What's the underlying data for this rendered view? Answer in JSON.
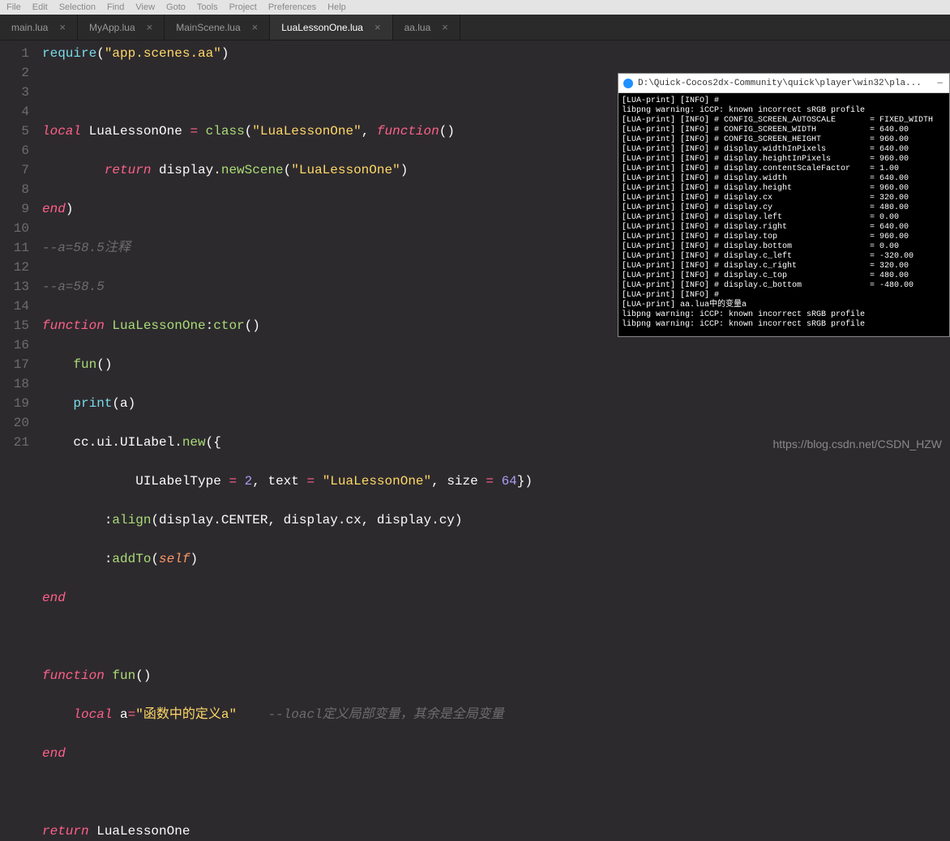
{
  "menu": [
    "File",
    "Edit",
    "Selection",
    "Find",
    "View",
    "Goto",
    "Tools",
    "Project",
    "Preferences",
    "Help"
  ],
  "tabs": [
    {
      "label": "main.lua",
      "active": false
    },
    {
      "label": "MyApp.lua",
      "active": false
    },
    {
      "label": "MainScene.lua",
      "active": false
    },
    {
      "label": "LuaLessonOne.lua",
      "active": true
    },
    {
      "label": "aa.lua",
      "active": false
    }
  ],
  "code": {
    "l1a": "require",
    "l1b": "(",
    "l1c": "\"app.scenes.aa\"",
    "l1d": ")",
    "l3a": "local",
    "l3b": " LuaLessonOne ",
    "l3c": "=",
    "l3d": " ",
    "l3e": "class",
    "l3f": "(",
    "l3g": "\"LuaLessonOne\"",
    "l3h": ", ",
    "l3i": "function",
    "l3j": "()",
    "l4a": "        ",
    "l4b": "return",
    "l4c": " display.",
    "l4d": "newScene",
    "l4e": "(",
    "l4f": "\"LuaLessonOne\"",
    "l4g": ")",
    "l5a": "end",
    "l5b": ")",
    "l6": "--a=58.5注释",
    "l7": "--a=58.5",
    "l8a": "function",
    "l8b": " ",
    "l8c": "LuaLessonOne",
    "l8d": ":",
    "l8e": "ctor",
    "l8f": "()",
    "l9a": "    ",
    "l9b": "fun",
    "l9c": "()",
    "l10a": "    ",
    "l10b": "print",
    "l10c": "(a)",
    "l11a": "    cc.ui.UILabel.",
    "l11b": "new",
    "l11c": "({",
    "l12a": "            UILabelType ",
    "l12b": "=",
    "l12c": " ",
    "l12d": "2",
    "l12e": ", text ",
    "l12f": "=",
    "l12g": " ",
    "l12h": "\"LuaLessonOne\"",
    "l12i": ", size ",
    "l12j": "=",
    "l12k": " ",
    "l12l": "64",
    "l12m": "})",
    "l13a": "        :",
    "l13b": "align",
    "l13c": "(display.CENTER, display.cx, display.cy)",
    "l14a": "        :",
    "l14b": "addTo",
    "l14c": "(",
    "l14d": "self",
    "l14e": ")",
    "l15": "end",
    "l17a": "function",
    "l17b": " ",
    "l17c": "fun",
    "l17d": "()",
    "l18a": "    ",
    "l18b": "local",
    "l18c": " a",
    "l18d": "=",
    "l18e": "\"函数中的定义a\"",
    "l18f": "    --loacl定义局部变量，其余是全局变量",
    "l19": "end",
    "l21a": "return",
    "l21b": " LuaLessonOne"
  },
  "lines": [
    "1",
    "2",
    "3",
    "4",
    "5",
    "6",
    "7",
    "8",
    "9",
    "10",
    "11",
    "12",
    "13",
    "14",
    "15",
    "16",
    "17",
    "18",
    "19",
    "20",
    "21"
  ],
  "console": {
    "title": "D:\\Quick-Cocos2dx-Community\\quick\\player\\win32\\pla...",
    "min": "—",
    "body": "[LUA-print] [INFO] #\nlibpng warning: iCCP: known incorrect sRGB profile\n[LUA-print] [INFO] # CONFIG_SCREEN_AUTOSCALE       = FIXED_WIDTH\n[LUA-print] [INFO] # CONFIG_SCREEN_WIDTH           = 640.00\n[LUA-print] [INFO] # CONFIG_SCREEN_HEIGHT          = 960.00\n[LUA-print] [INFO] # display.widthInPixels         = 640.00\n[LUA-print] [INFO] # display.heightInPixels        = 960.00\n[LUA-print] [INFO] # display.contentScaleFactor    = 1.00\n[LUA-print] [INFO] # display.width                 = 640.00\n[LUA-print] [INFO] # display.height                = 960.00\n[LUA-print] [INFO] # display.cx                    = 320.00\n[LUA-print] [INFO] # display.cy                    = 480.00\n[LUA-print] [INFO] # display.left                  = 0.00\n[LUA-print] [INFO] # display.right                 = 640.00\n[LUA-print] [INFO] # display.top                   = 960.00\n[LUA-print] [INFO] # display.bottom                = 0.00\n[LUA-print] [INFO] # display.c_left                = -320.00\n[LUA-print] [INFO] # display.c_right               = 320.00\n[LUA-print] [INFO] # display.c_top                 = 480.00\n[LUA-print] [INFO] # display.c_bottom              = -480.00\n[LUA-print] [INFO] #\n[LUA-print] aa.lua中的变量a\nlibpng warning: iCCP: known incorrect sRGB profile\nlibpng warning: iCCP: known incorrect sRGB profile"
  },
  "watermark": "https://blog.csdn.net/CSDN_HZW"
}
